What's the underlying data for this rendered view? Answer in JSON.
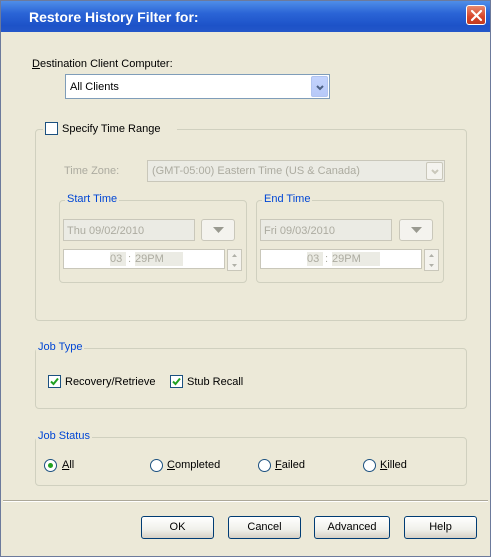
{
  "window": {
    "title": "Restore History Filter for:"
  },
  "destination": {
    "label": "Destination Client Computer:",
    "label_mnemonic": "D",
    "label_rest": "estination Client Computer:",
    "value": "All Clients"
  },
  "time_range": {
    "checkbox_label": "Specify Time Range",
    "checked": false,
    "timezone_label": "Time Zone:",
    "timezone_value": "(GMT-05:00) Eastern Time (US & Canada)",
    "start": {
      "title": "Start Time",
      "date": "Thu 09/02/2010",
      "hour": "03",
      "minute": "29",
      "ampm": "PM",
      "time": "29PM"
    },
    "end": {
      "title": "End Time",
      "date": "Fri 09/03/2010",
      "hour": "03",
      "minute": "29",
      "ampm": "PM",
      "time": "29PM"
    }
  },
  "job_type": {
    "title": "Job Type",
    "options": [
      {
        "label": "Recovery/Retrieve",
        "checked": true
      },
      {
        "label": "Stub Recall",
        "checked": true
      }
    ]
  },
  "job_status": {
    "title": "Job Status",
    "selected": "All",
    "options": [
      {
        "mnemonic": "A",
        "rest": "ll"
      },
      {
        "mnemonic": "C",
        "rest": "ompleted"
      },
      {
        "mnemonic": "F",
        "rest": "ailed"
      },
      {
        "mnemonic": "K",
        "rest": "illed"
      }
    ]
  },
  "buttons": {
    "ok": "OK",
    "cancel": "Cancel",
    "advanced": "Advanced",
    "help": "Help"
  },
  "colors": {
    "titlebar": "#2a64d6",
    "group_title": "#0046d5",
    "disabled_text": "#acaba0",
    "face": "#ece9d8"
  }
}
